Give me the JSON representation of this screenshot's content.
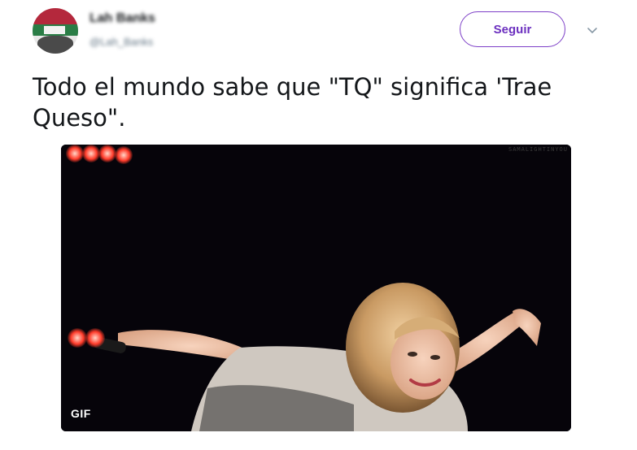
{
  "author": {
    "name": "Lah Banks",
    "handle": "@Lah_Banks"
  },
  "actions": {
    "follow_label": "Seguir",
    "more_icon": "chevron-down-icon"
  },
  "tweet": {
    "text_line1": "Todo el mundo sabe que \"TQ\" significa 'Trae",
    "text_line2": "Queso\"."
  },
  "media": {
    "badge": "GIF",
    "watermark": "SAMALIGHTINYOU",
    "accent_color": "#7d3fc7"
  }
}
